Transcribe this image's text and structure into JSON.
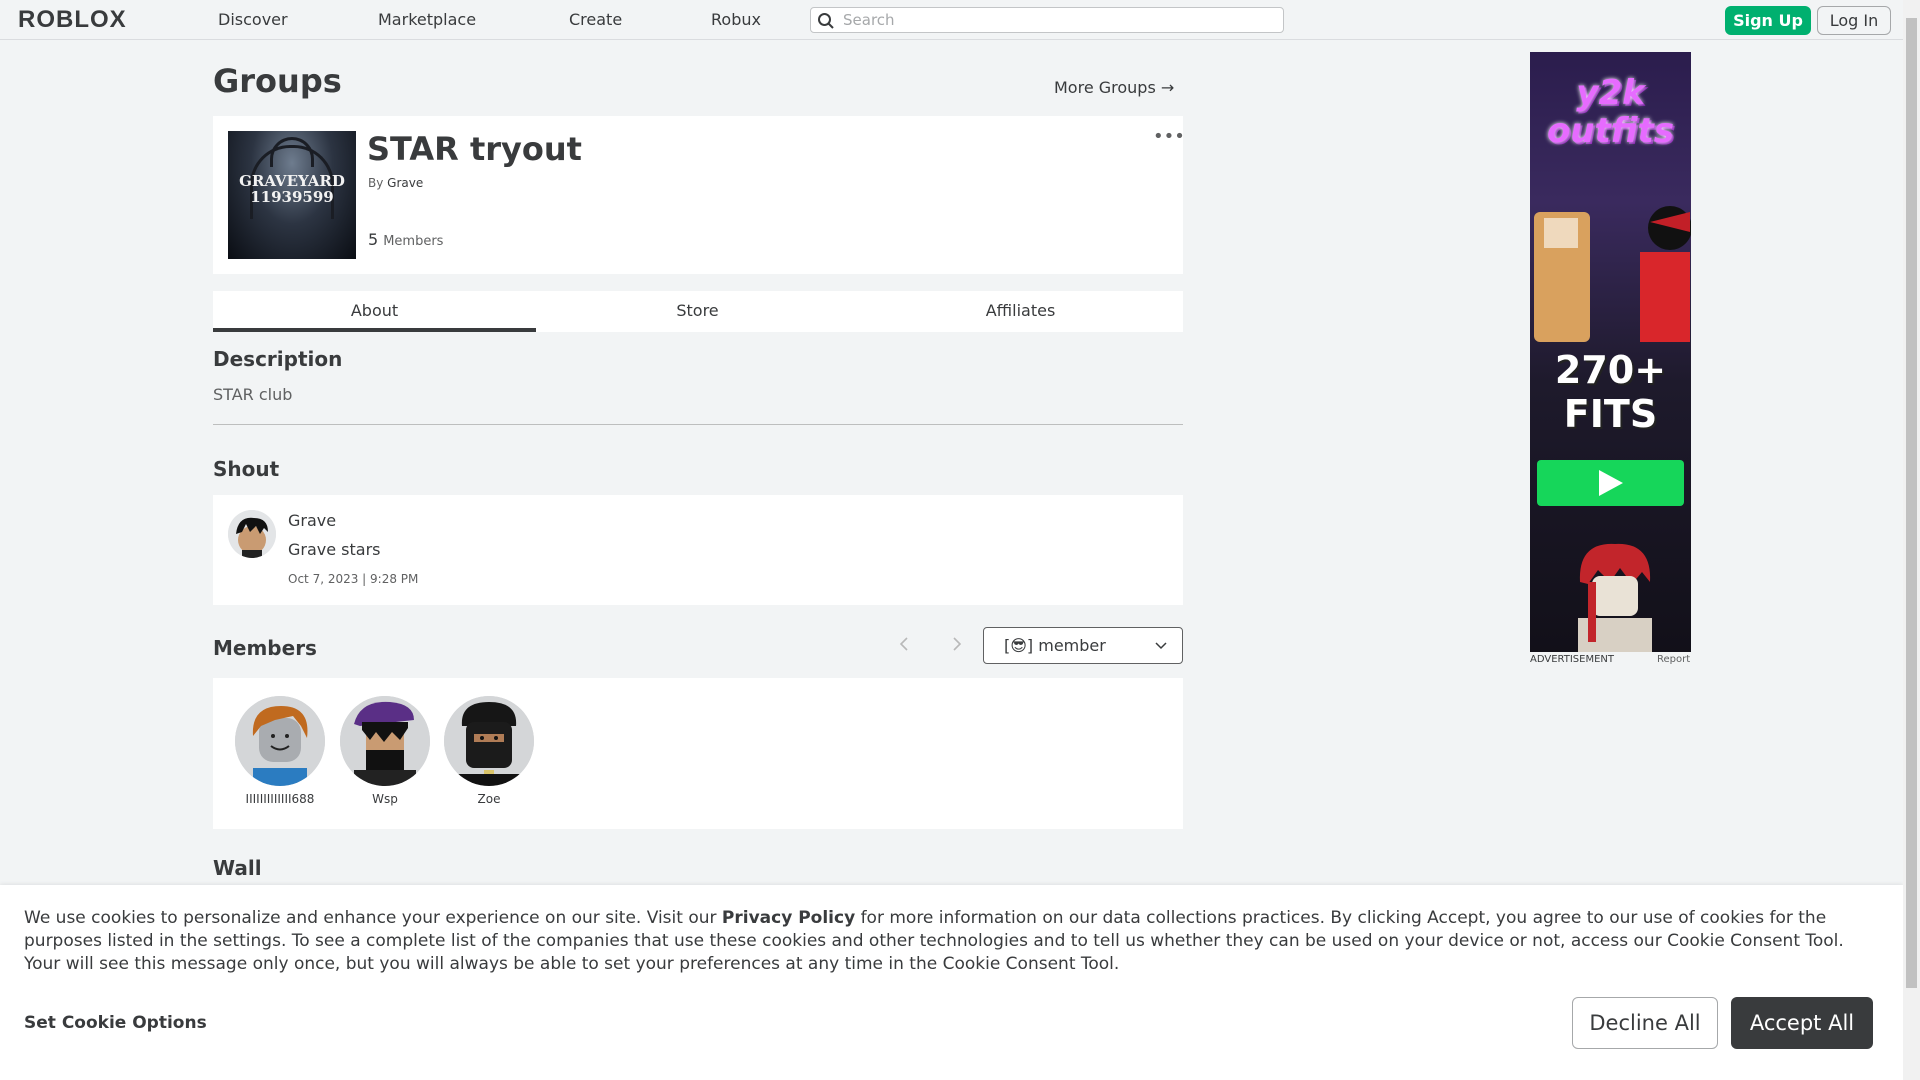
{
  "nav": {
    "logo": "ROBLOX",
    "links": [
      "Discover",
      "Marketplace",
      "Create",
      "Robux"
    ],
    "search_placeholder": "Search",
    "signup_label": "Sign Up",
    "login_label": "Log In"
  },
  "page": {
    "title": "Groups",
    "more_groups": "More Groups →"
  },
  "group": {
    "thumb_text_1": "GRAVEYARD",
    "thumb_text_2": "11939599",
    "name": "STAR tryout",
    "by_prefix": "By",
    "owner": "Grave",
    "member_count": "5",
    "members_label": "Members",
    "more_menu": "•••"
  },
  "tabs": [
    "About",
    "Store",
    "Affiliates"
  ],
  "description": {
    "heading": "Description",
    "text": "STAR club"
  },
  "shout": {
    "heading": "Shout",
    "author": "Grave",
    "body": "Grave stars",
    "date": "Oct 7, 2023 | 9:28 PM"
  },
  "members": {
    "heading": "Members",
    "role_selected": "[😎] member",
    "list": [
      {
        "name": "IIIIIIIIIIIII688"
      },
      {
        "name": "Wsp"
      },
      {
        "name": "Zoe"
      }
    ]
  },
  "wall": {
    "heading": "Wall"
  },
  "ad": {
    "title_line1": "y2k",
    "title_line2": "outfits",
    "big_line1": "270+",
    "big_line2": "FITS",
    "caption": "ADVERTISEMENT",
    "report": "Report"
  },
  "cookie": {
    "text_before": "We use cookies to personalize and enhance your experience on our site. Visit our ",
    "link": "Privacy Policy",
    "text_after": " for more information on our data collections practices. By clicking Accept, you agree to our use of cookies for the purposes listed in the settings. To see a complete list of the companies that use these cookies and other technologies and to tell us whether they can be used on your device or not, access our Cookie Consent Tool. Your will see this message only once, but you will always be able to set your preferences at any time in the Cookie Consent Tool.",
    "options": "Set Cookie Options",
    "decline": "Decline All",
    "accept": "Accept All"
  },
  "colors": {
    "background": "#f2f4f5",
    "card": "#ffffff",
    "text": "#393b3d",
    "signup_green": "#00b06f",
    "accept_dark": "#393b3d"
  }
}
